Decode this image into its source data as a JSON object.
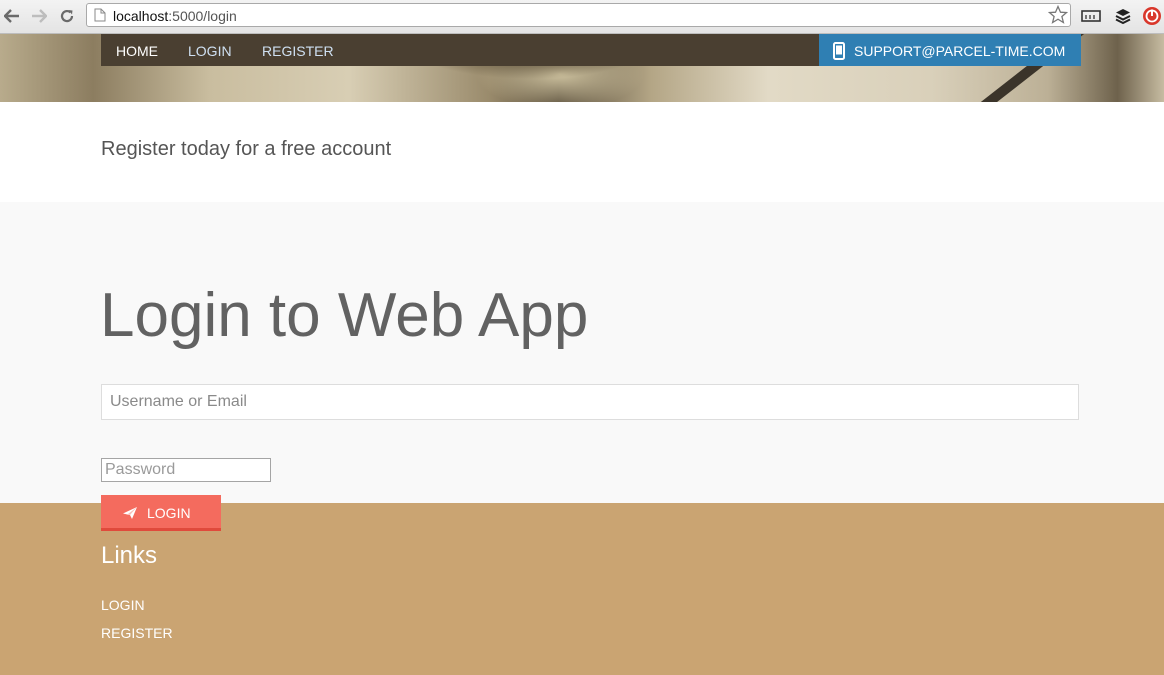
{
  "browser": {
    "url_host": "localhost",
    "url_rest": ":5000/login"
  },
  "nav": {
    "items": [
      {
        "label": "HOME",
        "color": "#ffffff"
      },
      {
        "label": "LOGIN",
        "color": "#cfe0f2"
      },
      {
        "label": "REGISTER",
        "color": "#cfe0f2"
      }
    ],
    "support_label": "SUPPORT@PARCEL-TIME.COM"
  },
  "tagline": "Register today for a free account",
  "login": {
    "title": "Login to Web App",
    "username_placeholder": "Username or Email",
    "username_value": "",
    "password_placeholder": "Password",
    "password_value": "",
    "button_label": "LOGIN"
  },
  "footer": {
    "heading": "Links",
    "links": [
      "LOGIN",
      "REGISTER"
    ]
  },
  "colors": {
    "nav_bg": "#4a3f31",
    "support_bg": "#2f7fb3",
    "button": "#f46b5e",
    "footer_bg": "#caa472",
    "section_bg": "#f9f9f9"
  }
}
